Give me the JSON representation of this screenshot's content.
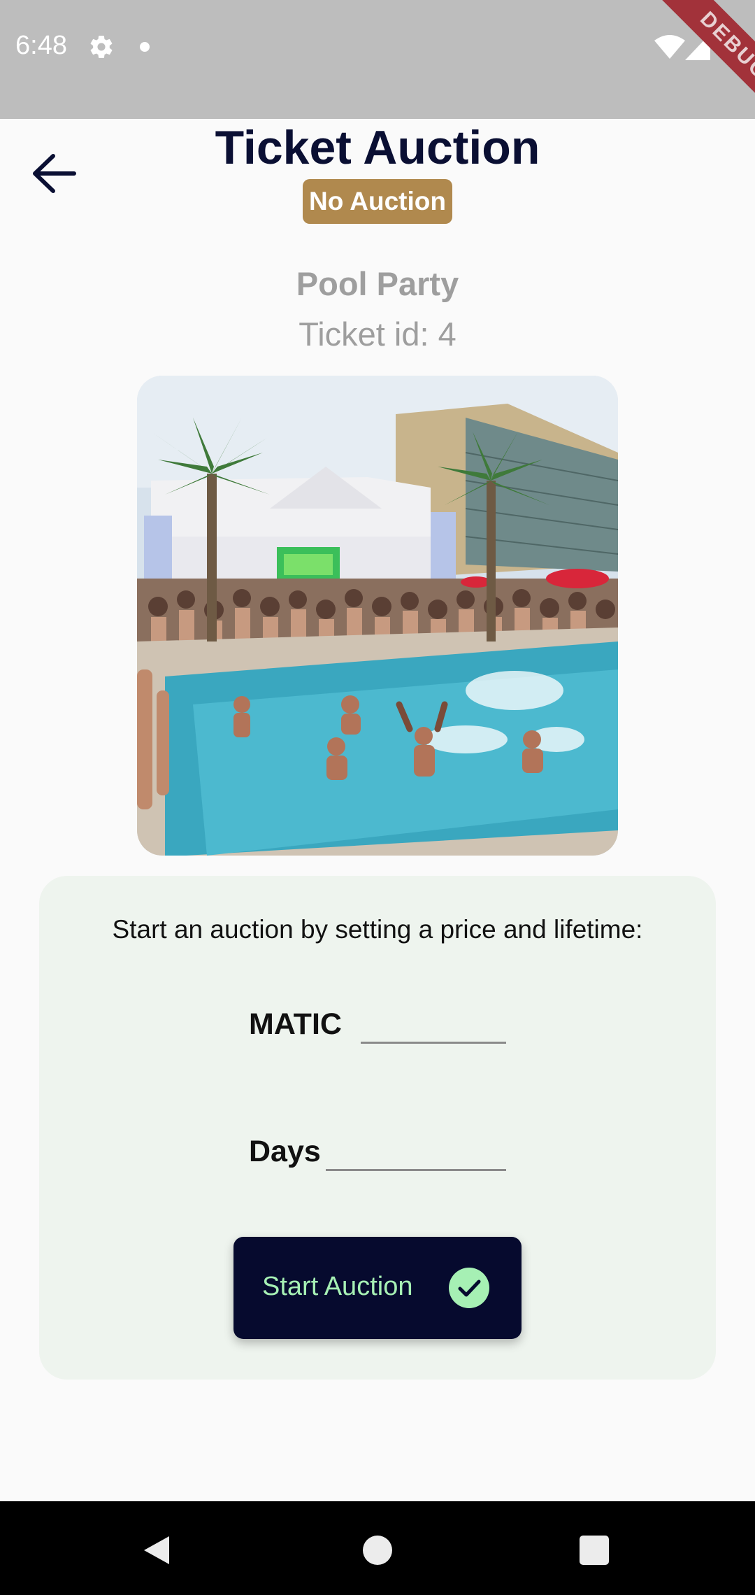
{
  "status_bar": {
    "time": "6:48",
    "debug_label": "DEBUG"
  },
  "header": {
    "title": "Ticket Auction",
    "badge": "No Auction",
    "badge_color": "#b0894e"
  },
  "ticket": {
    "event_name": "Pool Party",
    "ticket_id_text": "Ticket id: 4",
    "image_icon": "pool-party-photo"
  },
  "auction_form": {
    "prompt": "Start an auction by setting a price and lifetime:",
    "price_label": "MATIC",
    "price_value": "",
    "lifetime_label": "Days",
    "lifetime_value": "",
    "start_button_label": "Start Auction",
    "accent_color": "#a6f0b4",
    "button_color": "#060a2e"
  },
  "nav_bar": {
    "icons": [
      "back-triangle-icon",
      "home-circle-icon",
      "recents-square-icon"
    ]
  }
}
